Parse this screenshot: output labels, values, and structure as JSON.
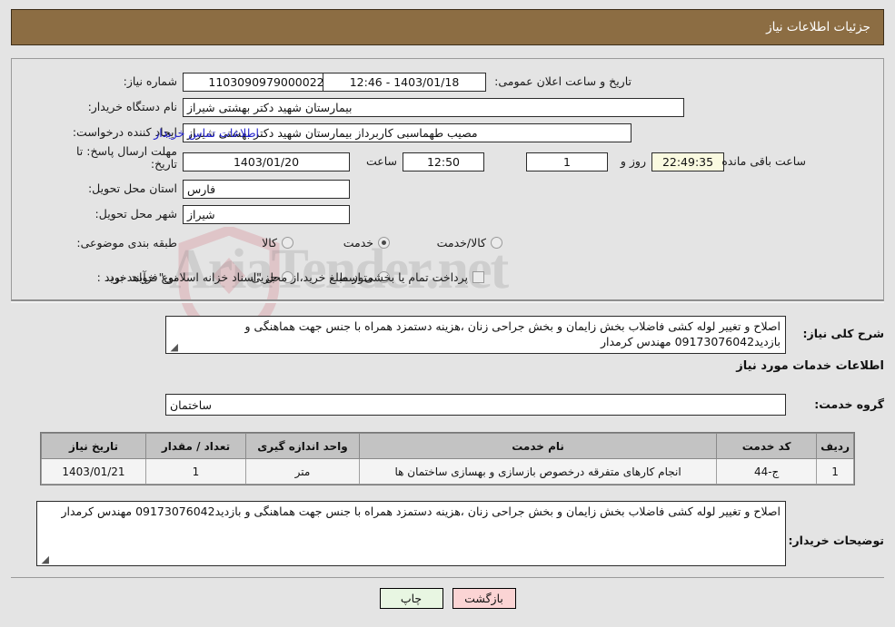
{
  "header": {
    "title": "جزئیات اطلاعات نیاز"
  },
  "watermark": {
    "text": "AriaTender.net"
  },
  "info": {
    "need_number_label": "شماره نیاز:",
    "need_number_value": "1103090979000022",
    "announce_label": "تاریخ و ساعت اعلان عمومی:",
    "announce_value": "1403/01/18 - 12:46",
    "buyer_org_label": "نام دستگاه خریدار:",
    "buyer_org_value": "بیمارستان شهید دکتر بهشتی شیراز",
    "creator_label": "ایجاد کننده درخواست:",
    "creator_value": "مصیب طهماسبی کاربرداز بیمارستان شهید دکتر بهشتی شیراز",
    "contact_link": "اطلاعات تماس خریدار",
    "deadline_label": "مهلت ارسال پاسخ: تا تاریخ:",
    "deadline_date": "1403/01/20",
    "deadline_hour_label": "ساعت",
    "deadline_hour_value": "12:50",
    "remaining_days_value": "1",
    "remaining_days_label": "روز و",
    "remaining_time_value": "22:49:35",
    "remaining_time_label": "ساعت باقی مانده",
    "province_label": "استان محل تحویل:",
    "province_value": "فارس",
    "city_label": "شهر محل تحویل:",
    "city_value": "شیراز",
    "category_label": "طبقه بندی موضوعی:",
    "category_options": [
      {
        "label": "کالا",
        "selected": false
      },
      {
        "label": "خدمت",
        "selected": true
      },
      {
        "label": "کالا/خدمت",
        "selected": false
      }
    ],
    "process_label": "نوع فرآیند خرید :",
    "process_options": [
      {
        "label": "جزیی",
        "selected": false
      },
      {
        "label": "متوسط",
        "selected": false
      }
    ],
    "treasury_checkbox_label": "پرداخت تمام یا بخشی از مبلغ خرید،از محل \"اسناد خزانه اسلامی\" خواهد بود.",
    "treasury_checked": false
  },
  "general": {
    "label": "شرح کلی نیاز:",
    "value": "اصلاح و تغییر لوله کشی فاضلاب  بخش زایمان و بخش جراحی زنان ،هزینه دستمزد همراه با جنس جهت هماهنگی و بازدید09173076042 مهندس کرمدار"
  },
  "services_section": {
    "title": "اطلاعات خدمات مورد نیاز",
    "group_label": "گروه خدمت:",
    "group_value": "ساختمان"
  },
  "table": {
    "headers": [
      "ردیف",
      "کد خدمت",
      "نام خدمت",
      "واحد اندازه گیری",
      "تعداد / مقدار",
      "تاریخ نیاز"
    ],
    "rows": [
      {
        "row_no": "1",
        "service_code": "ج-44",
        "service_name": "انجام کارهای متفرقه درخصوص بازسازی و بهسازی ساختمان ها",
        "unit": "متر",
        "quantity": "1",
        "need_date": "1403/01/21"
      }
    ]
  },
  "buyer_notes": {
    "label": "توضیحات خریدار:",
    "value": "اصلاح و تغییر لوله کشی فاضلاب  بخش زایمان و بخش جراحی زنان ،هزینه دستمزد همراه با جنس جهت هماهنگی و بازدید09173076042 مهندس کرمدار"
  },
  "footer": {
    "print_label": "چاپ",
    "back_label": "بازگشت"
  },
  "colors": {
    "header_bg": "#8c6d43",
    "page_bg": "#e4e4e4",
    "link": "#2222cc",
    "cream_field": "#fafae0",
    "print_btn": "#e8f6e2",
    "back_btn": "#fbd4d4",
    "table_header_bg": "#c3c3c3"
  }
}
